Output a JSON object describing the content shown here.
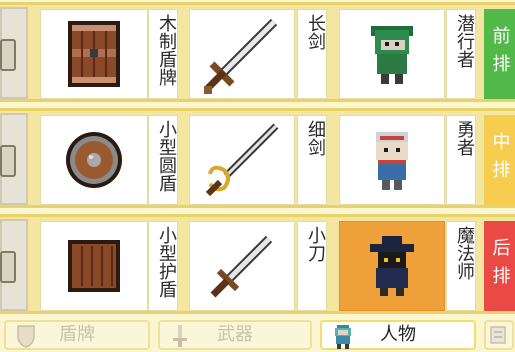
{
  "rows": [
    {
      "shield": {
        "name": "木制盾牌",
        "icon": "wooden-shield-icon"
      },
      "weapon": {
        "name": "长剑",
        "icon": "long-sword-icon"
      },
      "character": {
        "name": "潜行者",
        "icon": "rogue-icon",
        "highlighted": false
      },
      "position": {
        "label": "前排",
        "color": "#52b848"
      }
    },
    {
      "shield": {
        "name": "小型圆盾",
        "icon": "round-shield-icon"
      },
      "weapon": {
        "name": "细剑",
        "icon": "rapier-icon"
      },
      "character": {
        "name": "勇者",
        "icon": "hero-icon",
        "highlighted": false
      },
      "position": {
        "label": "中排",
        "color": "#f6cd4e"
      }
    },
    {
      "shield": {
        "name": "小型护盾",
        "icon": "small-shield-icon"
      },
      "weapon": {
        "name": "小刀",
        "icon": "knife-icon"
      },
      "character": {
        "name": "魔法师",
        "icon": "mage-icon",
        "highlighted": true
      },
      "position": {
        "label": "后排",
        "color": "#ea4a45"
      }
    }
  ],
  "tabs": [
    {
      "label": "盾牌",
      "icon": "shield-tab-icon",
      "active": false
    },
    {
      "label": "武器",
      "icon": "sword-tab-icon",
      "active": false
    },
    {
      "label": "人物",
      "icon": "character-tab-icon",
      "active": true
    },
    {
      "label": "",
      "icon": "more-tab-icon",
      "active": false
    }
  ]
}
